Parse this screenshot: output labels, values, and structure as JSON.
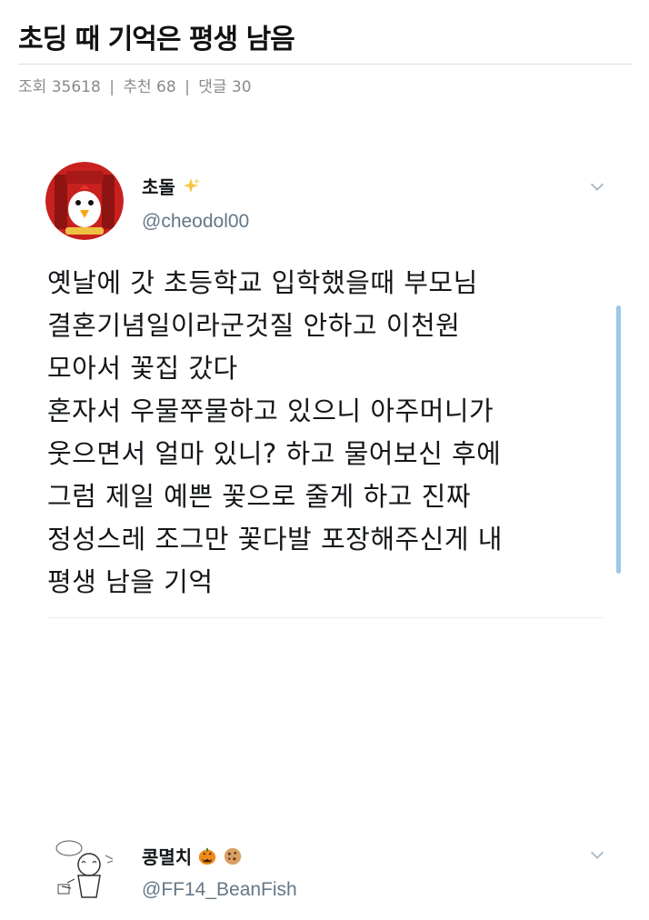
{
  "post": {
    "title": "초딩 때 기억은 평생 남음",
    "meta": {
      "views_label": "조회",
      "views": "35618",
      "recommend_label": "추천",
      "recommends": "68",
      "comments_label": "댓글",
      "comments": "30",
      "separator": "|"
    }
  },
  "tweets": [
    {
      "display_name": "초돌",
      "name_emoji": "sparkles-icon",
      "handle": "@cheodol00",
      "lines": [
        "옛날에 갓 초등학교 입학했을때 부모님",
        "결혼기념일이라군것질 안하고 이천원",
        "모아서 꽃집 갔다",
        "혼자서 우물쭈물하고 있으니 아주머니가",
        "웃으면서 얼마 있니? 하고 물어보신 후에",
        "그럼 제일 예쁜 꽃으로 줄게 하고 진짜",
        "정성스레 조그만 꽃다발 포장해주신게 내",
        "평생 남을 기억"
      ]
    },
    {
      "display_name": "콩멸치",
      "name_emoji": [
        "jack-o-lantern-icon",
        "cookie-icon"
      ],
      "handle": "@FF14_BeanFish"
    }
  ],
  "colors": {
    "accent": "#9cc7e8",
    "handle": "#657786",
    "meta": "#8a8a8a",
    "avatar_red": "#c8201e"
  }
}
